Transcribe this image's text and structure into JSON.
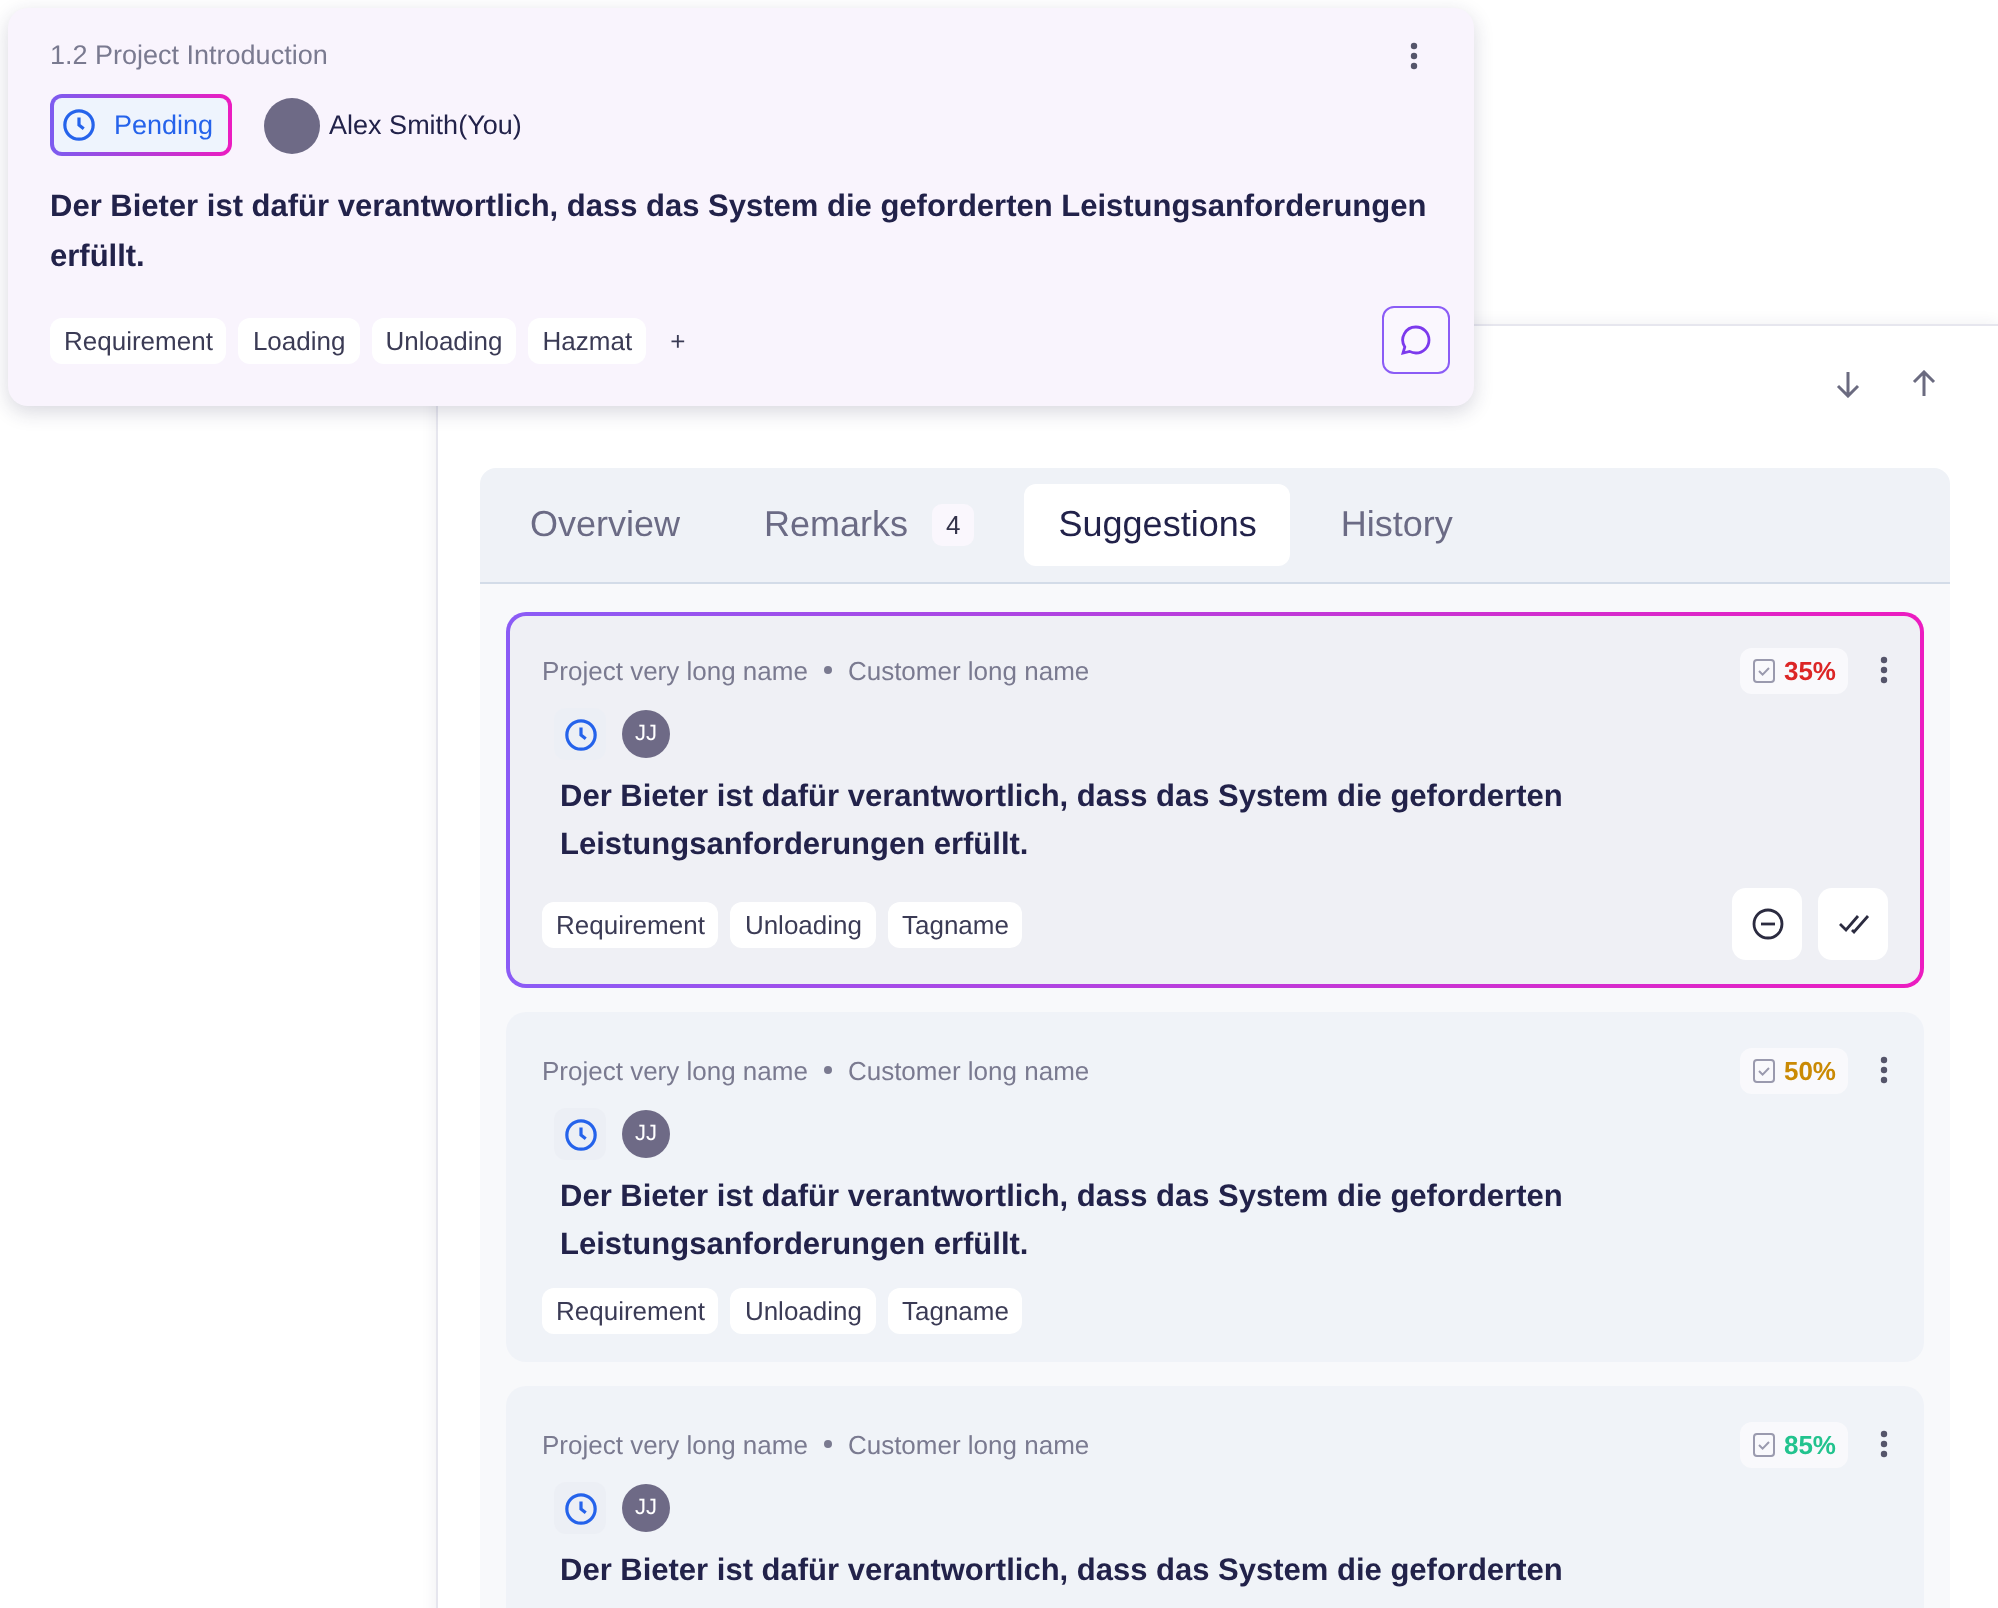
{
  "floating_card": {
    "title": "1.2 Project Introduction",
    "status": "Pending",
    "assignee": "Alex Smith(You)",
    "text": "Der Bieter ist dafür verantwortlich, dass das System die geforderten Leistungsanforderungen erfüllt.",
    "tags": [
      "Requirement",
      "Loading",
      "Unloading",
      "Hazmat"
    ],
    "add_tag": "+"
  },
  "tabs": [
    {
      "label": "Overview",
      "selected": false
    },
    {
      "label": "Remarks",
      "badge": "4",
      "selected": false
    },
    {
      "label": "Suggestions",
      "selected": true
    },
    {
      "label": "History",
      "selected": false
    }
  ],
  "suggestions": [
    {
      "project": "Project very long name",
      "customer": "Customer long name",
      "score": "35%",
      "color": "#dc2626",
      "avatar": "JJ",
      "text": "Der Bieter ist dafür verantwortlich, dass das System die geforderten Leistungsanforderungen erfüllt.",
      "tags": [
        "Requirement",
        "Unloading",
        "Tagname"
      ],
      "selected": true
    },
    {
      "project": "Project very long name",
      "customer": "Customer long name",
      "score": "50%",
      "color": "#ca8a04",
      "avatar": "JJ",
      "text": "Der Bieter ist dafür verantwortlich, dass das System die geforderten Leistungsanforderungen erfüllt.",
      "tags": [
        "Requirement",
        "Unloading",
        "Tagname"
      ],
      "selected": false
    },
    {
      "project": "Project very long name",
      "customer": "Customer long name",
      "score": "85%",
      "color": "#22c38e",
      "avatar": "JJ",
      "text": "Der Bieter ist dafür verantwortlich, dass das System die geforderten",
      "selected": false
    }
  ]
}
